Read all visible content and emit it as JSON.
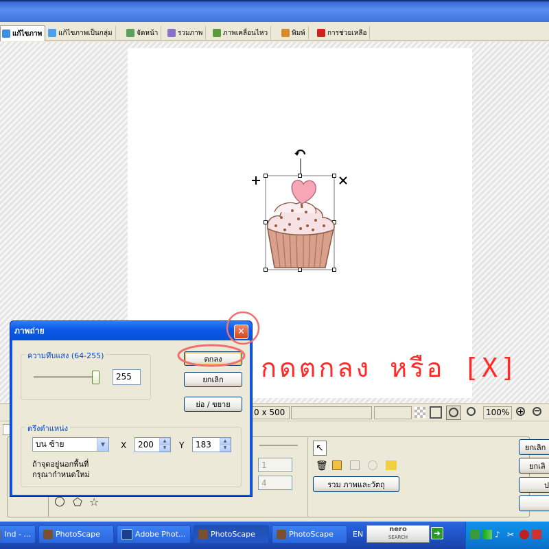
{
  "tabs": [
    {
      "label": "แก้ไขภาพ",
      "active": true,
      "icon": "photo-edit-icon",
      "color": "#3a8ee6"
    },
    {
      "label": "แก้ไขภาพเป็นกลุ่ม",
      "active": false,
      "icon": "batch-edit-icon",
      "color": "#4fa0e8"
    },
    {
      "label": "จัดหน้า",
      "active": false,
      "icon": "page-layout-icon",
      "color": "#5aa05a"
    },
    {
      "label": "รวมภาพ",
      "active": false,
      "icon": "combine-icon",
      "color": "#8a70c8"
    },
    {
      "label": "ภาพเคลื่อนไหว",
      "active": false,
      "icon": "animation-icon",
      "color": "#5b9b3a"
    },
    {
      "label": "พิมพ์",
      "active": false,
      "icon": "print-icon",
      "color": "#d48a2a"
    },
    {
      "label": "การช่วยเหลือ",
      "active": false,
      "icon": "help-icon",
      "color": "#d02020"
    }
  ],
  "status": {
    "size": "0 x 500",
    "zoom": "100%"
  },
  "dialog": {
    "title": "ภาพถ่าย",
    "opacity_group": "ความทึบแสง (64-255)",
    "opacity_value": "255",
    "opacity_level": 1.0,
    "ok": "ตกลง",
    "cancel": "ยกเลิก",
    "resize": "ย่อ / ขยาย",
    "position_group": "ตรึงตำแหน่ง",
    "anchor": "บน ซ้าย",
    "x_label": "X",
    "x_value": "200",
    "y_label": "Y",
    "y_value": "183",
    "note": "ถ้าจุดอยู่นอกพื้นที่\nกรุณากำหนดใหม่"
  },
  "panel": {
    "field1": "1",
    "field2": "4",
    "combine_button": "รวม ภาพและวัตถุ",
    "right_btn1": "ยกเลิก",
    "right_btn2": "ยกเลิ",
    "right_btn3": "ป"
  },
  "annotation": "กดตกลง หรือ [X]",
  "taskbar": {
    "items": [
      {
        "label": "Ind - ...",
        "icon": "window-icon"
      },
      {
        "label": "PhotoScape",
        "icon": "photoscape-icon"
      },
      {
        "label": "Adobe Phot...",
        "icon": "photoshop-icon"
      },
      {
        "label": "PhotoScape",
        "icon": "photoscape-icon"
      },
      {
        "label": "PhotoScape",
        "icon": "photoscape-icon"
      }
    ],
    "lang": "EN",
    "nero_top": "nero",
    "nero_bottom": "SEARCH"
  }
}
